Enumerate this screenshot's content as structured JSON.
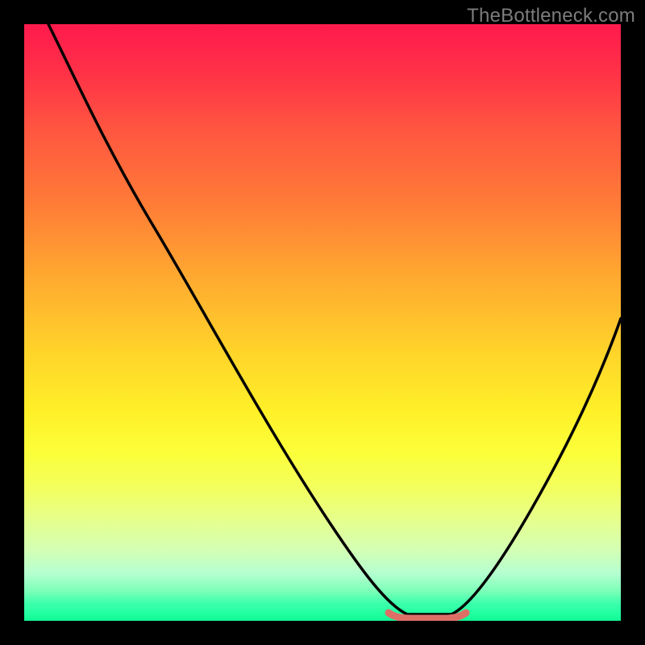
{
  "watermark": "TheBottleneck.com",
  "chart_data": {
    "type": "line",
    "title": "",
    "xlabel": "",
    "ylabel": "",
    "xlim": [
      0,
      100
    ],
    "ylim": [
      0,
      100
    ],
    "grid": false,
    "legend": false,
    "gradient_stops": [
      {
        "pos": 0,
        "color": "#ff1a4d"
      },
      {
        "pos": 8,
        "color": "#ff3147"
      },
      {
        "pos": 18,
        "color": "#ff5740"
      },
      {
        "pos": 30,
        "color": "#ff7b37"
      },
      {
        "pos": 42,
        "color": "#ffa830"
      },
      {
        "pos": 55,
        "color": "#ffd42a"
      },
      {
        "pos": 65,
        "color": "#fff028"
      },
      {
        "pos": 72,
        "color": "#fbff3a"
      },
      {
        "pos": 78,
        "color": "#f2ff60"
      },
      {
        "pos": 83,
        "color": "#e6ff8c"
      },
      {
        "pos": 88,
        "color": "#d4ffb3"
      },
      {
        "pos": 92,
        "color": "#b6ffd0"
      },
      {
        "pos": 95,
        "color": "#7cffb8"
      },
      {
        "pos": 97,
        "color": "#3effad"
      },
      {
        "pos": 99,
        "color": "#1dff9f"
      },
      {
        "pos": 100,
        "color": "#10f592"
      }
    ],
    "series": [
      {
        "name": "curve",
        "color": "#000000",
        "points": [
          {
            "x": 4,
            "y": 100
          },
          {
            "x": 10,
            "y": 88
          },
          {
            "x": 20,
            "y": 70
          },
          {
            "x": 30,
            "y": 52
          },
          {
            "x": 40,
            "y": 35
          },
          {
            "x": 50,
            "y": 18
          },
          {
            "x": 58,
            "y": 6
          },
          {
            "x": 63,
            "y": 1
          },
          {
            "x": 67,
            "y": 0.5
          },
          {
            "x": 71,
            "y": 1
          },
          {
            "x": 76,
            "y": 6
          },
          {
            "x": 82,
            "y": 15
          },
          {
            "x": 90,
            "y": 30
          },
          {
            "x": 100,
            "y": 51
          }
        ]
      }
    ],
    "highlight": {
      "name": "optimal-range",
      "color": "#de6f67",
      "x_range": [
        61,
        73
      ],
      "y": 0.7
    }
  }
}
